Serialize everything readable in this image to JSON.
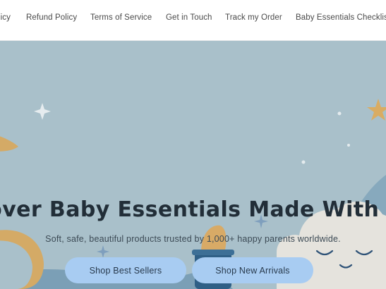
{
  "nav": {
    "items": [
      "licy",
      "Refund Policy",
      "Terms of Service",
      "Get in Touch",
      "Track my Order",
      "Baby Essentials Checklis"
    ]
  },
  "hero": {
    "headline": "cover Baby Essentials Made With Lo",
    "subtext": "Soft, safe, beautiful products trusted by 1,000+ happy parents worldwide.",
    "buttons": {
      "best_sellers": "Shop Best Sellers",
      "new_arrivals": "Shop New Arrivals"
    }
  },
  "colors": {
    "hero_background": "#a9c0ca",
    "button_background": "#a8ccf2",
    "headline_text": "#222e38",
    "star_gold": "#d6ad68"
  },
  "icons": [
    "sparkle-icon",
    "star-icon",
    "moon-icon",
    "cloud-icon",
    "baby-bottle-icon"
  ]
}
